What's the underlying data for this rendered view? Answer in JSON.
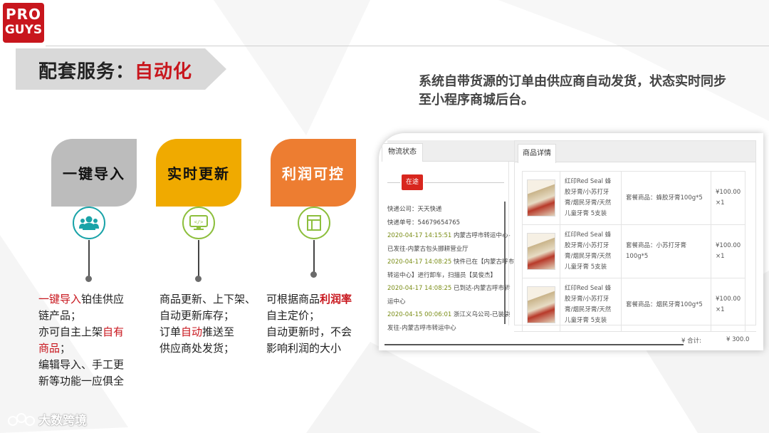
{
  "logo": {
    "line1": "PRO",
    "line2": "GUYS"
  },
  "title": {
    "prefix": "配套服务：",
    "highlight": "自动化"
  },
  "description": "系统自带货源的订单由供应商自动发货，状态实时同步至小程序商城后台。",
  "colors": {
    "brand_red": "#c8161d",
    "gray_card": "#bcbcbc",
    "yellow_card": "#f0aa00",
    "orange_card": "#ed7d31",
    "teal": "#1aa3a8",
    "green": "#8dbf3d"
  },
  "features": [
    {
      "label": "一键导入",
      "icon": "users-icon",
      "lines": [
        [
          {
            "t": "一键导入",
            "s": "r"
          },
          {
            "t": "铂佳供应"
          }
        ],
        [
          {
            "t": "链产品；"
          }
        ],
        [
          {
            "t": "亦可自主上架"
          },
          {
            "t": "自有",
            "s": "r"
          }
        ],
        [
          {
            "t": "商品",
            "s": "r"
          },
          {
            "t": "；"
          }
        ],
        [
          {
            "t": "编辑导入、手工更"
          }
        ],
        [
          {
            "t": "新等功能一应俱全"
          }
        ]
      ]
    },
    {
      "label": "实时更新",
      "icon": "monitor-code-icon",
      "lines": [
        [
          {
            "t": "商品更新、上下架、"
          }
        ],
        [
          {
            "t": "自动更新库存；"
          }
        ],
        [
          {
            "t": "订单"
          },
          {
            "t": "自动",
            "s": "r"
          },
          {
            "t": "推送至"
          }
        ],
        [
          {
            "t": "供应商处发货；"
          }
        ]
      ]
    },
    {
      "label": "利润可控",
      "icon": "document-icon",
      "lines": [
        [
          {
            "t": "可根据商品"
          },
          {
            "t": "利润率",
            "s": "rb"
          }
        ],
        [
          {
            "t": "自主定价；"
          }
        ],
        [
          {
            "t": "自动更新时，不会"
          }
        ],
        [
          {
            "t": "影响利润的大小"
          }
        ]
      ]
    }
  ],
  "logistics": {
    "tab": "物流状态",
    "badge": "在途",
    "lines": [
      [
        {
          "t": "快递公司：天天快递"
        }
      ],
      [
        {
          "t": "快递单号：54679654765"
        }
      ],
      [
        {
          "t": "2020-04-17 14:15:51",
          "g": true
        },
        {
          "t": " 内蒙古呼市转运中心-"
        }
      ],
      [
        {
          "t": "已发往-内蒙古包头挪耕营业厅"
        }
      ],
      [
        {
          "t": "2020-04-17 14:08:25",
          "g": true
        },
        {
          "t": " 快件已在【内蒙古呼市"
        }
      ],
      [
        {
          "t": "转运中心】进行卸车，扫描员【吴俊杰】"
        }
      ],
      [
        {
          "t": "2020-04-17 14:08:25",
          "g": true
        },
        {
          "t": " 已到达-内蒙古呼市转"
        }
      ],
      [
        {
          "t": "运中心"
        }
      ],
      [
        {
          "t": "2020-04-15 00:06:01",
          "g": true
        },
        {
          "t": " 浙江义乌公司-已装袋"
        }
      ],
      [
        {
          "t": "发往-内蒙古呼市转运中心"
        }
      ]
    ]
  },
  "product_detail": {
    "tab": "商品详情",
    "items": [
      {
        "name": "红印Red Seal 蜂胶牙膏/小苏打牙膏/烟民牙膏/天然儿童牙膏 5支装",
        "spec": "套餐商品：蜂胶牙膏100g*5",
        "price": "¥100.00",
        "qty": "×1"
      },
      {
        "name": "红印Red Seal 蜂胶牙膏/小苏打牙膏/烟民牙膏/天然儿童牙膏 5支装",
        "spec": "套餐商品：小苏打牙膏100g*5",
        "price": "¥100.00",
        "qty": "×1"
      },
      {
        "name": "红印Red Seal 蜂胶牙膏/小苏打牙膏/烟民牙膏/天然儿童牙膏 5支装",
        "spec": "套餐商品：烟民牙膏100g*5",
        "price": "¥100.00",
        "qty": "×1"
      }
    ],
    "total_label": "¥ 合计:",
    "total_value": "¥ 300.0"
  },
  "watermark": "大数跨境"
}
